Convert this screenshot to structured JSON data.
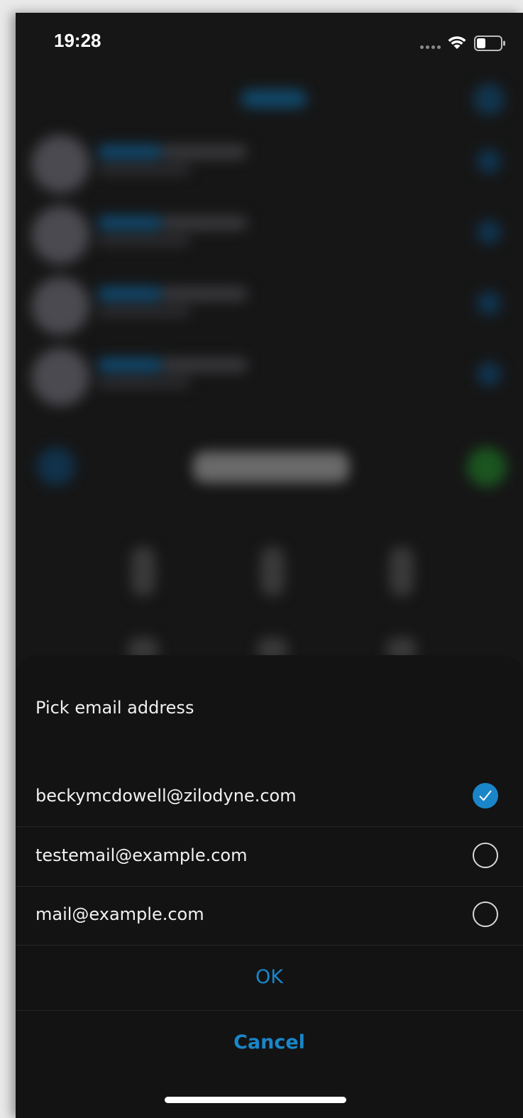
{
  "status_bar": {
    "time": "19:28",
    "icons": [
      "cellular-signal-icon",
      "wifi-icon",
      "battery-icon"
    ]
  },
  "sheet": {
    "title": "Pick email address",
    "options": [
      {
        "label": "beckymcdowell@zilodyne.com",
        "selected": true
      },
      {
        "label": "testemail@example.com",
        "selected": false
      },
      {
        "label": "mail@example.com",
        "selected": false
      }
    ],
    "ok_label": "OK",
    "cancel_label": "Cancel"
  },
  "colors": {
    "accent": "#1a86c9",
    "sheet_background": "#131313",
    "text": "#f2f2f2"
  }
}
